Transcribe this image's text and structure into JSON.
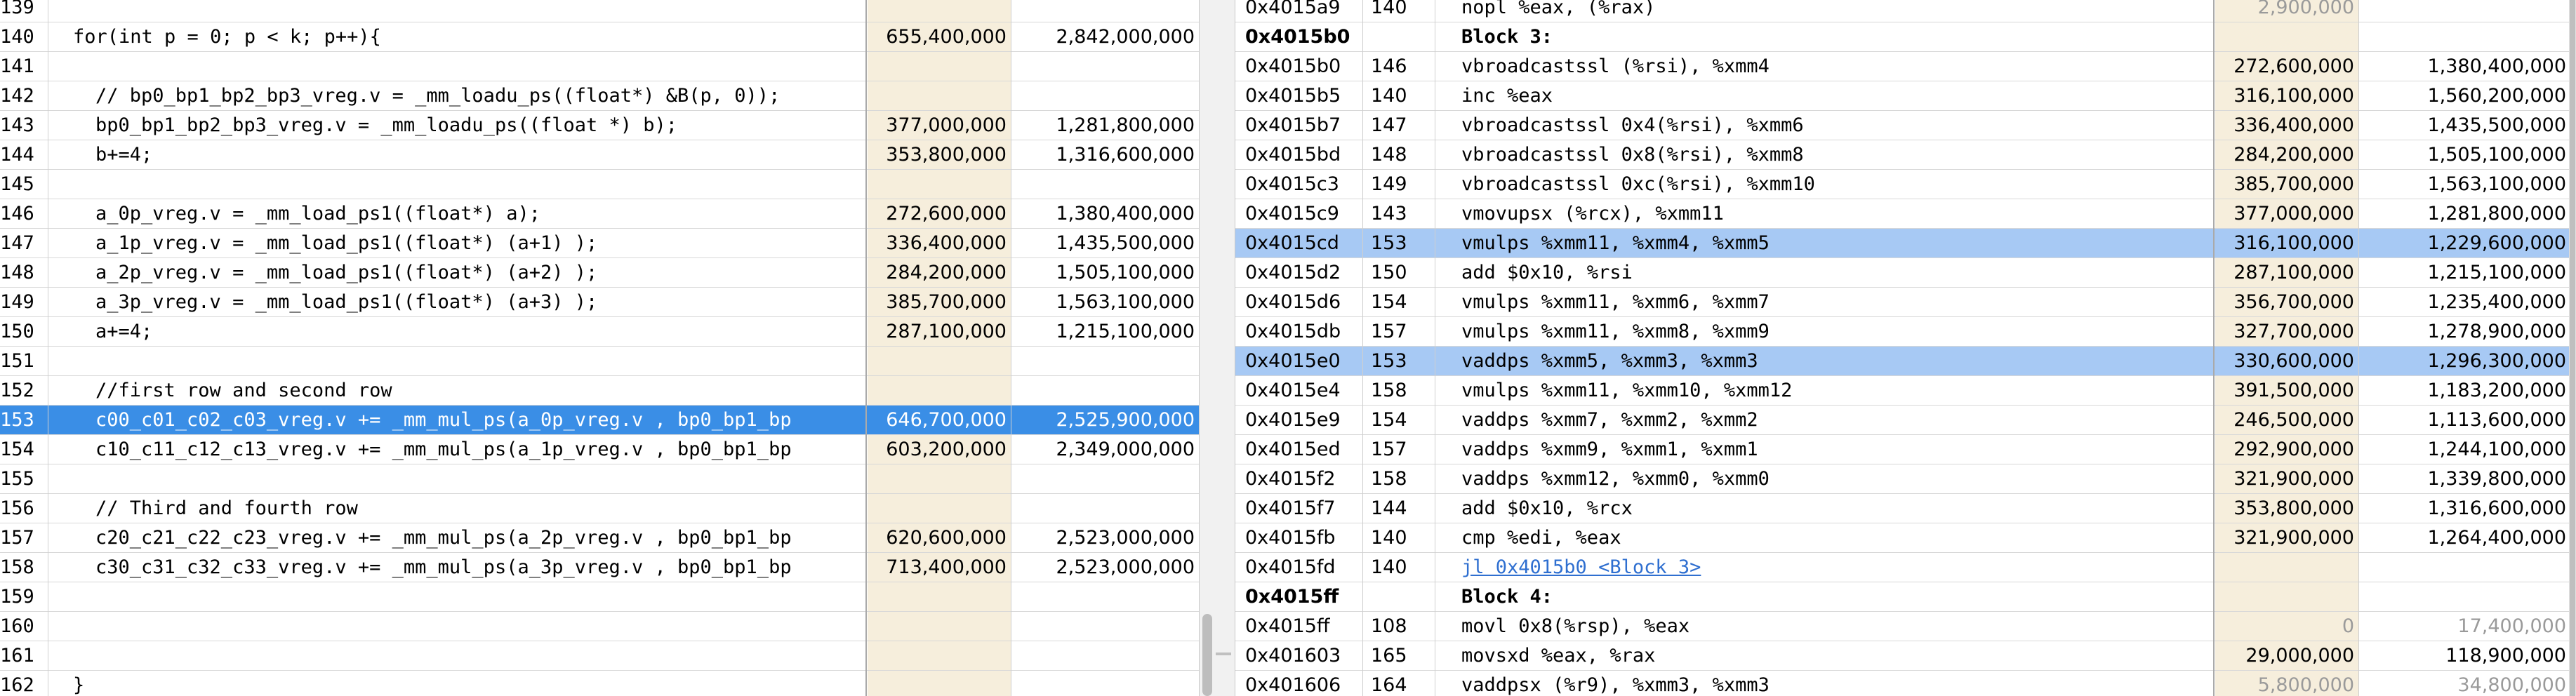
{
  "source_pane": {
    "rows": [
      {
        "line": "139",
        "code": "",
        "c1": "",
        "c2": ""
      },
      {
        "line": "140",
        "code": "for(int p = 0; p < k; p++){",
        "indent": 1,
        "c1": "655,400,000",
        "c2": "2,842,000,000"
      },
      {
        "line": "141",
        "code": "",
        "c1": "",
        "c2": ""
      },
      {
        "line": "142",
        "code": "// bp0_bp1_bp2_bp3_vreg.v = _mm_loadu_ps((float*) &B(p, 0));",
        "indent": 2,
        "c1": "",
        "c2": ""
      },
      {
        "line": "143",
        "code": "bp0_bp1_bp2_bp3_vreg.v = _mm_loadu_ps((float *) b);",
        "indent": 2,
        "c1": "377,000,000",
        "c2": "1,281,800,000"
      },
      {
        "line": "144",
        "code": "b+=4;",
        "indent": 2,
        "c1": "353,800,000",
        "c2": "1,316,600,000"
      },
      {
        "line": "145",
        "code": "",
        "c1": "",
        "c2": ""
      },
      {
        "line": "146",
        "code": "a_0p_vreg.v = _mm_load_ps1((float*) a);",
        "indent": 2,
        "c1": "272,600,000",
        "c2": "1,380,400,000"
      },
      {
        "line": "147",
        "code": "a_1p_vreg.v = _mm_load_ps1((float*) (a+1) );",
        "indent": 2,
        "c1": "336,400,000",
        "c2": "1,435,500,000"
      },
      {
        "line": "148",
        "code": "a_2p_vreg.v = _mm_load_ps1((float*) (a+2) );",
        "indent": 2,
        "c1": "284,200,000",
        "c2": "1,505,100,000"
      },
      {
        "line": "149",
        "code": "a_3p_vreg.v = _mm_load_ps1((float*) (a+3) );",
        "indent": 2,
        "c1": "385,700,000",
        "c2": "1,563,100,000"
      },
      {
        "line": "150",
        "code": "a+=4;",
        "indent": 2,
        "c1": "287,100,000",
        "c2": "1,215,100,000"
      },
      {
        "line": "151",
        "code": "",
        "c1": "",
        "c2": ""
      },
      {
        "line": "152",
        "code": "//first row and second row",
        "indent": 2,
        "c1": "",
        "c2": ""
      },
      {
        "line": "153",
        "code": "c00_c01_c02_c03_vreg.v += _mm_mul_ps(a_0p_vreg.v , bp0_bp1_bp",
        "indent": 2,
        "c1": "646,700,000",
        "c2": "2,525,900,000",
        "selected": true
      },
      {
        "line": "154",
        "code": "c10_c11_c12_c13_vreg.v += _mm_mul_ps(a_1p_vreg.v , bp0_bp1_bp",
        "indent": 2,
        "c1": "603,200,000",
        "c2": "2,349,000,000"
      },
      {
        "line": "155",
        "code": "",
        "c1": "",
        "c2": ""
      },
      {
        "line": "156",
        "code": "// Third and fourth row",
        "indent": 2,
        "c1": "",
        "c2": ""
      },
      {
        "line": "157",
        "code": "c20_c21_c22_c23_vreg.v += _mm_mul_ps(a_2p_vreg.v , bp0_bp1_bp",
        "indent": 2,
        "c1": "620,600,000",
        "c2": "2,523,000,000"
      },
      {
        "line": "158",
        "code": "c30_c31_c32_c33_vreg.v += _mm_mul_ps(a_3p_vreg.v , bp0_bp1_bp",
        "indent": 2,
        "c1": "713,400,000",
        "c2": "2,523,000,000"
      },
      {
        "line": "159",
        "code": "",
        "c1": "",
        "c2": ""
      },
      {
        "line": "160",
        "code": "",
        "c1": "",
        "c2": ""
      },
      {
        "line": "161",
        "code": "",
        "c1": "",
        "c2": ""
      },
      {
        "line": "162",
        "code": "}",
        "indent": 1,
        "c1": "",
        "c2": ""
      }
    ]
  },
  "asm_pane": {
    "rows": [
      {
        "addr": "0x4015a9",
        "line": "140",
        "instr": "nopl  %eax, (%rax)",
        "c1": "2,900,000",
        "c2": "",
        "dim": true
      },
      {
        "addr": "0x4015b0",
        "line": "",
        "instr": "Block 3:",
        "c1": "",
        "c2": "",
        "block": true
      },
      {
        "addr": "0x4015b0",
        "line": "146",
        "instr": "vbroadcastssl  (%rsi), %xmm4",
        "c1": "272,600,000",
        "c2": "1,380,400,000"
      },
      {
        "addr": "0x4015b5",
        "line": "140",
        "instr": "inc %eax",
        "c1": "316,100,000",
        "c2": "1,560,200,000"
      },
      {
        "addr": "0x4015b7",
        "line": "147",
        "instr": "vbroadcastssl  0x4(%rsi), %xmm6",
        "c1": "336,400,000",
        "c2": "1,435,500,000"
      },
      {
        "addr": "0x4015bd",
        "line": "148",
        "instr": "vbroadcastssl  0x8(%rsi), %xmm8",
        "c1": "284,200,000",
        "c2": "1,505,100,000"
      },
      {
        "addr": "0x4015c3",
        "line": "149",
        "instr": "vbroadcastssl  0xc(%rsi), %xmm10",
        "c1": "385,700,000",
        "c2": "1,563,100,000"
      },
      {
        "addr": "0x4015c9",
        "line": "143",
        "instr": "vmovupsx  (%rcx), %xmm11",
        "c1": "377,000,000",
        "c2": "1,281,800,000"
      },
      {
        "addr": "0x4015cd",
        "line": "153",
        "instr": "vmulps %xmm11, %xmm4, %xmm5",
        "c1": "316,100,000",
        "c2": "1,229,600,000",
        "selected": true
      },
      {
        "addr": "0x4015d2",
        "line": "150",
        "instr": "add $0x10, %rsi",
        "c1": "287,100,000",
        "c2": "1,215,100,000"
      },
      {
        "addr": "0x4015d6",
        "line": "154",
        "instr": "vmulps %xmm11, %xmm6, %xmm7",
        "c1": "356,700,000",
        "c2": "1,235,400,000"
      },
      {
        "addr": "0x4015db",
        "line": "157",
        "instr": "vmulps %xmm11, %xmm8, %xmm9",
        "c1": "327,700,000",
        "c2": "1,278,900,000"
      },
      {
        "addr": "0x4015e0",
        "line": "153",
        "instr": "vaddps %xmm5, %xmm3, %xmm3",
        "c1": "330,600,000",
        "c2": "1,296,300,000",
        "selected": true
      },
      {
        "addr": "0x4015e4",
        "line": "158",
        "instr": "vmulps %xmm11, %xmm10, %xmm12",
        "c1": "391,500,000",
        "c2": "1,183,200,000"
      },
      {
        "addr": "0x4015e9",
        "line": "154",
        "instr": "vaddps %xmm7, %xmm2, %xmm2",
        "c1": "246,500,000",
        "c2": "1,113,600,000"
      },
      {
        "addr": "0x4015ed",
        "line": "157",
        "instr": "vaddps %xmm9, %xmm1, %xmm1",
        "c1": "292,900,000",
        "c2": "1,244,100,000"
      },
      {
        "addr": "0x4015f2",
        "line": "158",
        "instr": "vaddps %xmm12, %xmm0, %xmm0",
        "c1": "321,900,000",
        "c2": "1,339,800,000"
      },
      {
        "addr": "0x4015f7",
        "line": "144",
        "instr": "add $0x10, %rcx",
        "c1": "353,800,000",
        "c2": "1,316,600,000"
      },
      {
        "addr": "0x4015fb",
        "line": "140",
        "instr": "cmp %edi, %eax",
        "c1": "321,900,000",
        "c2": "1,264,400,000"
      },
      {
        "addr": "0x4015fd",
        "line": "140",
        "instr": "jl 0x4015b0 <Block 3>",
        "c1": "",
        "c2": "",
        "link": true
      },
      {
        "addr": "0x4015ff",
        "line": "",
        "instr": "Block 4:",
        "c1": "",
        "c2": "",
        "block": true
      },
      {
        "addr": "0x4015ff",
        "line": "108",
        "instr": "movl  0x8(%rsp), %eax",
        "c1": "0",
        "c2": "17,400,000",
        "dim": true
      },
      {
        "addr": "0x401603",
        "line": "165",
        "instr": "movsxd %eax, %rax",
        "c1": "29,000,000",
        "c2": "118,900,000"
      },
      {
        "addr": "0x401606",
        "line": "164",
        "instr": "vaddpsx  (%r9), %xmm3, %xmm3",
        "c1": "5,800,000",
        "c2": "34,800,000",
        "dim": true
      }
    ]
  }
}
